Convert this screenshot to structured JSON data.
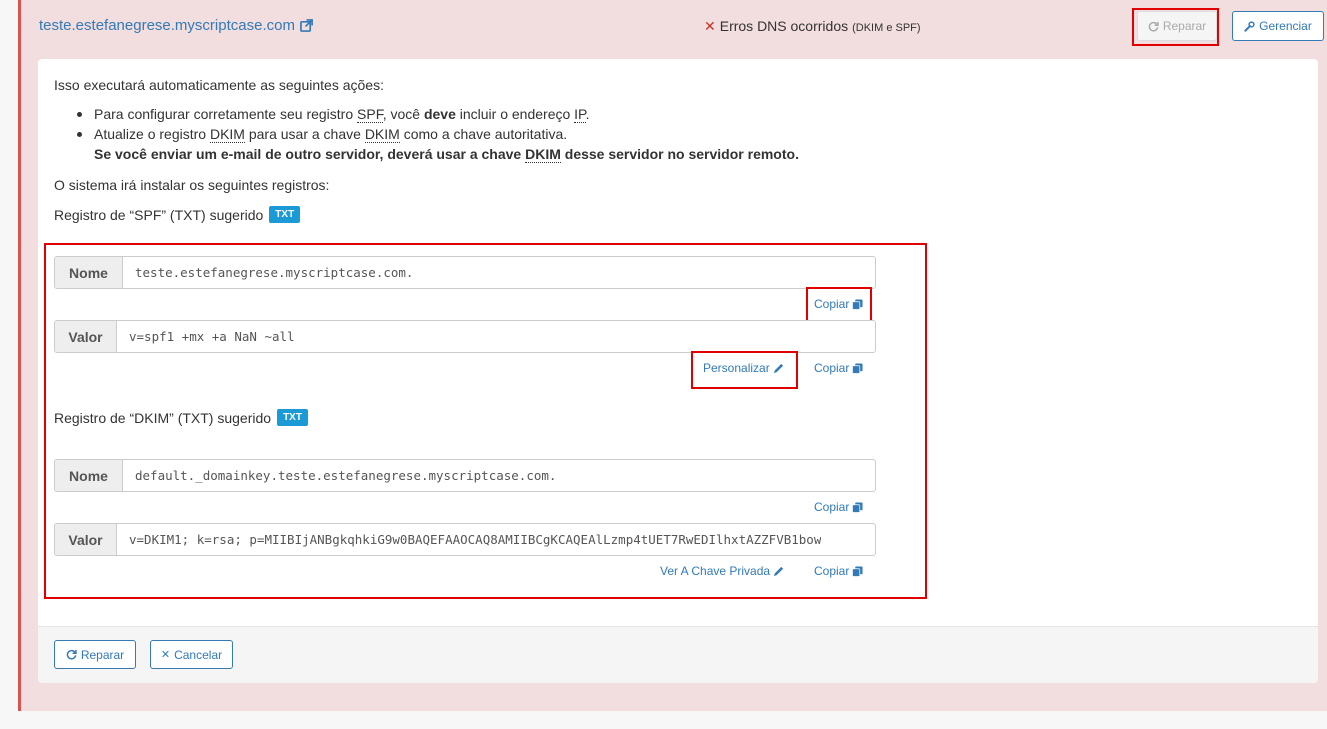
{
  "header": {
    "domain": "teste.estefanegrese.myscriptcase.com",
    "status_text": "Erros DNS ocorridos",
    "status_detail": "(DKIM e SPF)",
    "repair_label": "Reparar",
    "manage_label": "Gerenciar"
  },
  "body": {
    "intro": "Isso executará automaticamente as seguintes ações:",
    "bullet1": {
      "pre": "Para configurar corretamente seu registro ",
      "abbr1": "SPF",
      "mid": ", você ",
      "bold": "deve",
      "post": " incluir o endereço ",
      "abbr2": "IP",
      "end": "."
    },
    "bullet2": {
      "pre": "Atualize o registro ",
      "abbr1": "DKIM",
      "mid": " para usar a chave ",
      "abbr2": "DKIM",
      "post": " como a chave autoritativa."
    },
    "bullet2_bold": {
      "pre": "Se você enviar um e-mail de outro servidor, deverá usar a chave ",
      "abbr": "DKIM",
      "post": " desse servidor no servidor remoto."
    },
    "install": "O sistema irá instalar os seguintes registros:",
    "spf_heading": "Registro de “SPF” (TXT) sugerido",
    "dkim_heading": "Registro de “DKIM” (TXT) sugerido",
    "badge": "TXT"
  },
  "spf": {
    "name_label": "Nome",
    "name_value": "teste.estefanegrese.myscriptcase.com.",
    "value_label": "Valor",
    "value_value": "v=spf1 +mx +a NaN ~all"
  },
  "dkim": {
    "name_label": "Nome",
    "name_value": "default._domainkey.teste.estefanegrese.myscriptcase.com.",
    "value_label": "Valor",
    "value_value": "v=DKIM1; k=rsa; p=MIIBIjANBgkqhkiG9w0BAQEFAAOCAQ8AMIIBCgKCAQEAlLzmp4tUET7RwEDIlhxtAZZFVB1bow"
  },
  "links": {
    "copy": "Copiar",
    "customize": "Personalizar",
    "private_key": "Ver A Chave Privada"
  },
  "footer": {
    "repair": "Reparar",
    "cancel": "Cancelar"
  },
  "colors": {
    "panel_bg": "#f2dede",
    "panel_border": "#d9534f",
    "link": "#337ab7",
    "badge": "#1c9ad6",
    "highlight": "#e00000",
    "error_x": "#c9302c"
  },
  "icons": [
    "external-link-icon",
    "refresh-icon",
    "wrench-icon",
    "copy-icon",
    "pencil-icon",
    "times-icon"
  ]
}
